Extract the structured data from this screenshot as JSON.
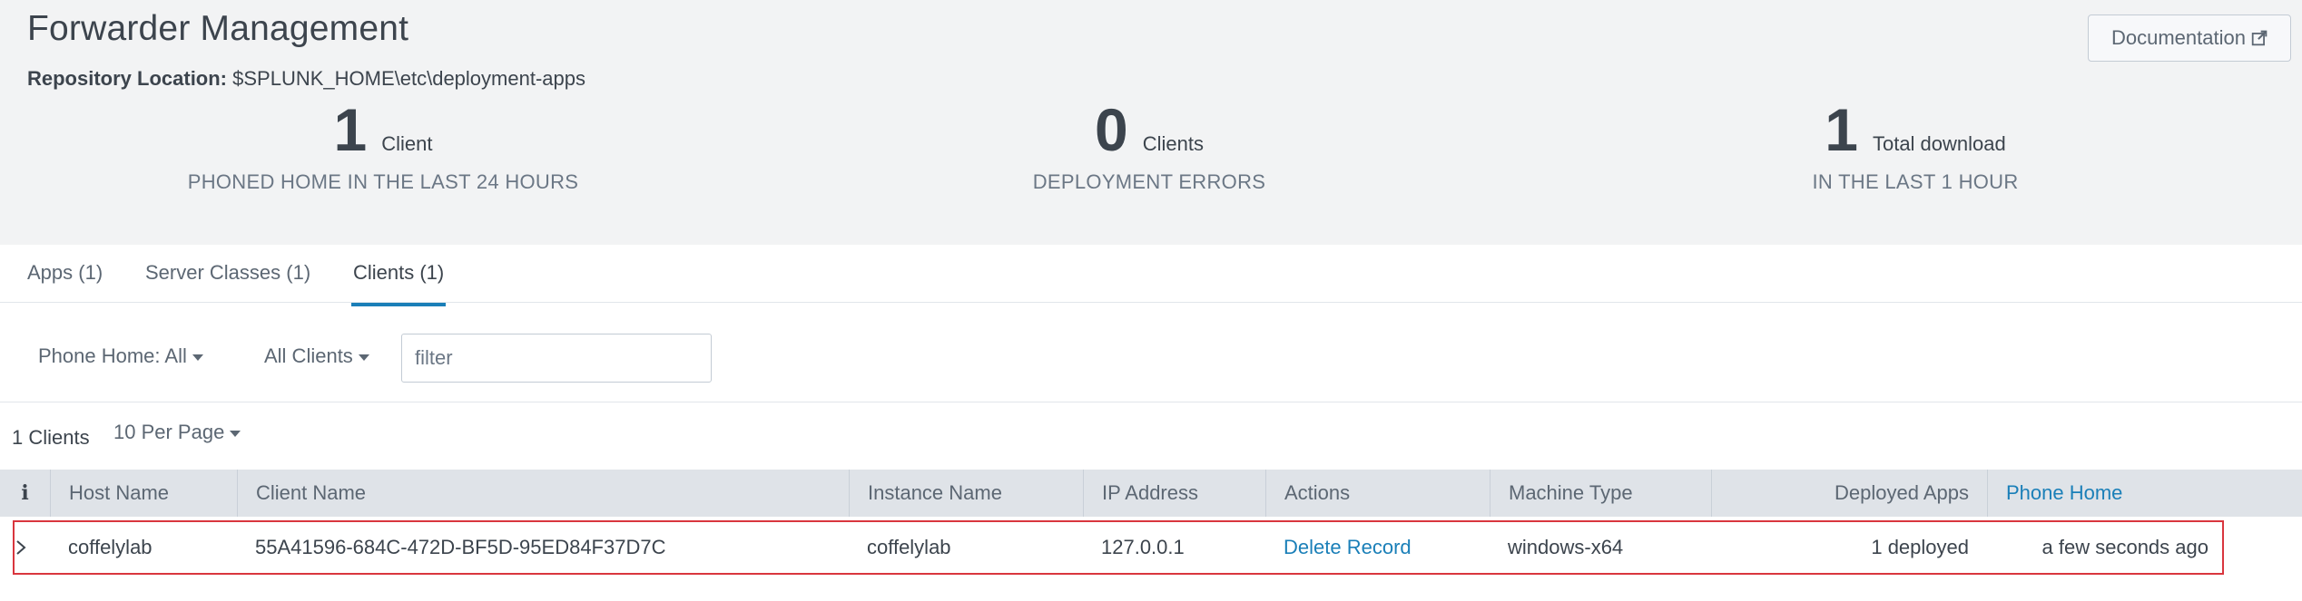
{
  "page": {
    "title": "Forwarder Management",
    "repo_label": "Repository Location:",
    "repo_path": " $SPLUNK_HOME\\etc\\deployment-apps",
    "documentation_label": "Documentation"
  },
  "stats": [
    {
      "number": "1",
      "unit": "Client",
      "sub": "PHONED HOME IN THE LAST 24 HOURS"
    },
    {
      "number": "0",
      "unit": "Clients",
      "sub": "DEPLOYMENT ERRORS"
    },
    {
      "number": "1",
      "unit": "Total download",
      "sub": "IN THE LAST 1 HOUR"
    }
  ],
  "tabs": [
    {
      "label": "Apps (1)",
      "active": false
    },
    {
      "label": "Server Classes (1)",
      "active": false
    },
    {
      "label": "Clients (1)",
      "active": true
    }
  ],
  "filters": {
    "phone_home": "Phone Home: All",
    "clients": "All Clients",
    "filter_placeholder": "filter",
    "filter_value": ""
  },
  "list": {
    "count": "1 Clients",
    "per_page": "10 Per Page"
  },
  "table": {
    "info_icon": "i",
    "columns": [
      "Host Name",
      "Client Name",
      "Instance Name",
      "IP Address",
      "Actions",
      "Machine Type",
      "Deployed Apps",
      "Phone Home"
    ],
    "sorted_column": "Phone Home",
    "rows": [
      {
        "host_name": "coffelylab",
        "client_name": "55A41596-684C-472D-BF5D-95ED84F37D7C",
        "instance_name": "coffelylab",
        "ip_address": "127.0.0.1",
        "action": "Delete Record",
        "machine_type": "windows-x64",
        "deployed_apps": "1 deployed",
        "phone_home": "a few seconds ago"
      }
    ]
  },
  "colors": {
    "accent": "#1a7fb8",
    "header_bg": "#f2f3f4",
    "highlight": "#d9363e"
  }
}
